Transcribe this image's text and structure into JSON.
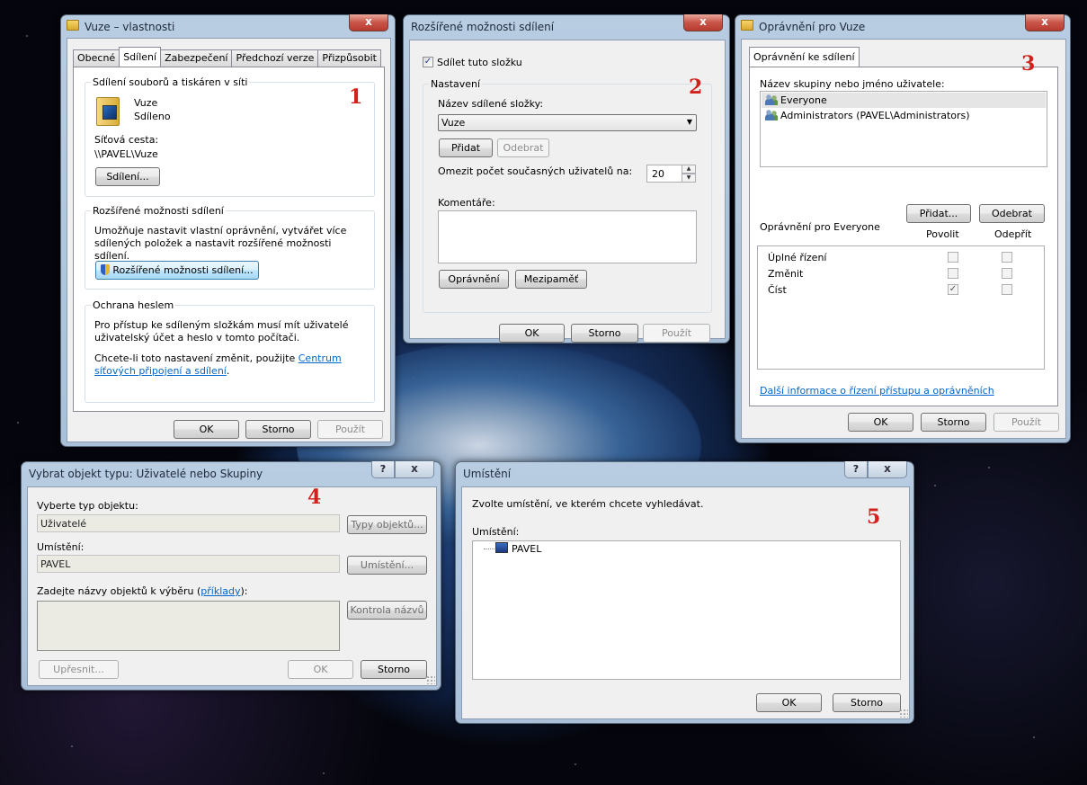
{
  "win1": {
    "title": "Vuze – vlastnosti",
    "close": "x",
    "tabs": [
      "Obecné",
      "Sdílení",
      "Zabezpečení",
      "Předchozí verze",
      "Přizpůsobit"
    ],
    "group1_label": "Sdílení souborů a tiskáren v síti",
    "folder_name": "Vuze",
    "folder_state": "Sdíleno",
    "path_label": "Síťová cesta:",
    "path_value": "\\\\PAVEL\\Vuze",
    "share_btn": "Sdílení...",
    "group2_label": "Rozšířené možnosti sdílení",
    "group2_text": "Umožňuje nastavit vlastní oprávnění, vytvářet více sdílených položek a nastavit rozšířené možnosti sdílení.",
    "advanced_btn": "Rozšířené možnosti sdílení...",
    "group3_label": "Ochrana heslem",
    "group3_text": "Pro přístup ke sdíleným složkám musí mít uživatelé uživatelský účet a heslo v tomto počítači.",
    "group3_text2": "Chcete-li toto nastavení změnit, použijte",
    "group3_link": "Centrum síťových připojení a sdílení",
    "group3_dot": ".",
    "ok": "OK",
    "cancel": "Storno",
    "apply": "Použít",
    "marker": "1"
  },
  "win2": {
    "title": "Rozšířené možnosti sdílení",
    "close": "x",
    "share_check_label": "Sdílet tuto složku",
    "share_checked": "✓",
    "group_label": "Nastavení",
    "share_name_label": "Název sdílené složky:",
    "share_name_value": "Vuze",
    "dropdown_arrow": "▼",
    "add_btn": "Přidat",
    "remove_btn": "Odebrat",
    "limit_label": "Omezit počet současných uživatelů na:",
    "limit_value": "20",
    "spin_up": "▲",
    "spin_down": "▼",
    "comment_label": "Komentáře:",
    "permissions_btn": "Oprávnění",
    "cache_btn": "Mezipaměť",
    "ok": "OK",
    "cancel": "Storno",
    "apply": "Použít",
    "marker": "2"
  },
  "win3": {
    "title": "Oprávnění pro Vuze",
    "close": "x",
    "tab": "Oprávnění ke sdílení",
    "list_label": "Název skupiny nebo jméno uživatele:",
    "users": [
      "Everyone",
      "Administrators (PAVEL\\Administrators)"
    ],
    "add_btn": "Přidat...",
    "remove_btn": "Odebrat",
    "perm_label": "Oprávnění pro Everyone",
    "allow_col": "Povolit",
    "deny_col": "Odepřít",
    "perms": [
      "Úplné řízení",
      "Změnit",
      "Číst"
    ],
    "check_mark": "✓",
    "link": "Další informace o řízení přístupu a oprávněních",
    "ok": "OK",
    "cancel": "Storno",
    "apply": "Použít",
    "marker": "3"
  },
  "win4": {
    "title": "Vybrat objekt typu: Uživatelé nebo Skupiny",
    "help": "?",
    "close": "x",
    "type_label": "Vyberte typ objektu:",
    "type_value": "Uživatelé",
    "type_btn": "Typy objektů...",
    "loc_label": "Umístění:",
    "loc_value": "PAVEL",
    "loc_btn": "Umístění...",
    "names_label_prefix": "Zadejte názvy objektů k výběru (",
    "names_label_link": "příklady",
    "names_label_suffix": "):",
    "check_btn": "Kontrola názvů",
    "advanced_btn": "Upřesnit...",
    "ok": "OK",
    "cancel": "Storno",
    "marker": "4"
  },
  "win5": {
    "title": "Umístění",
    "help": "?",
    "close": "x",
    "instruction": "Zvolte umístění, ve kterém chcete vyhledávat.",
    "loc_label": "Umístění:",
    "tree_item": "PAVEL",
    "ok": "OK",
    "cancel": "Storno",
    "marker": "5"
  }
}
